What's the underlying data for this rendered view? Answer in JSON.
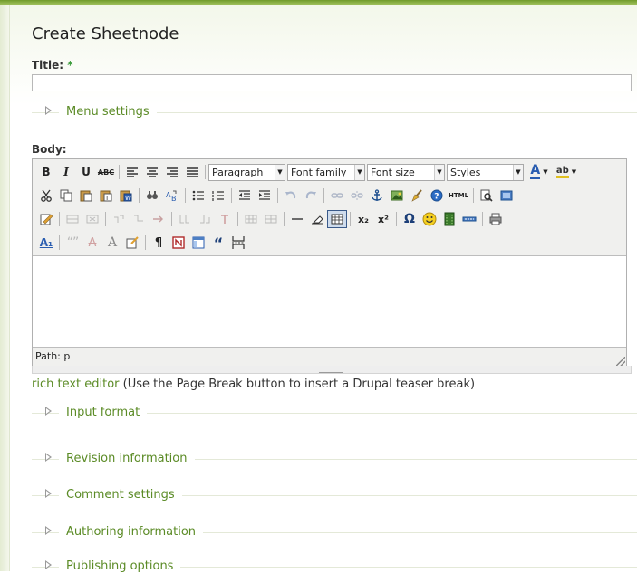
{
  "page": {
    "title": "Create Sheetnode"
  },
  "title_field": {
    "label": "Title:",
    "required_marker": "*",
    "value": ""
  },
  "fieldsets": {
    "menu": "Menu settings",
    "input_format": "Input format",
    "revision": "Revision information",
    "comment": "Comment settings",
    "authoring": "Authoring information",
    "publishing": "Publishing options"
  },
  "body": {
    "label": "Body:",
    "path_label": "Path: p",
    "rte_link": "rich text editor",
    "rte_note": " (Use the Page Break button to insert a Drupal teaser break)"
  },
  "toolbar": {
    "bold": "B",
    "italic": "I",
    "underline": "U",
    "strike": "ABC",
    "format_select": "Paragraph",
    "font_family_select": "Font family",
    "font_size_select": "Font size",
    "styles_select": "Styles",
    "text_color": "A",
    "highlight": "ab",
    "html": "HTML",
    "subscript": "x₂",
    "superscript": "x²",
    "omega": "Ω",
    "pilcrow": "¶",
    "quote": "“",
    "abbr": "A₁"
  },
  "colors": {
    "accent_green": "#5b8b26",
    "required": "#3a9b3a",
    "top_bar": "#6f9a2a"
  },
  "icons": [
    "cut-icon",
    "copy-icon",
    "paste-icon",
    "paste-text-icon",
    "paste-word-icon",
    "find-icon",
    "replace-icon",
    "bullet-list-icon",
    "numbered-list-icon",
    "outdent-icon",
    "indent-icon",
    "undo-icon",
    "redo-icon",
    "link-icon",
    "unlink-icon",
    "anchor-icon",
    "image-icon",
    "cleanup-icon",
    "help-icon",
    "html-icon",
    "preview-icon",
    "fullscreen-icon",
    "edit-css-icon",
    "table-icon",
    "horizontal-rule-icon",
    "eraser-icon",
    "special-char-icon",
    "emotion-icon",
    "media-icon",
    "page-break-icon",
    "print-icon"
  ]
}
